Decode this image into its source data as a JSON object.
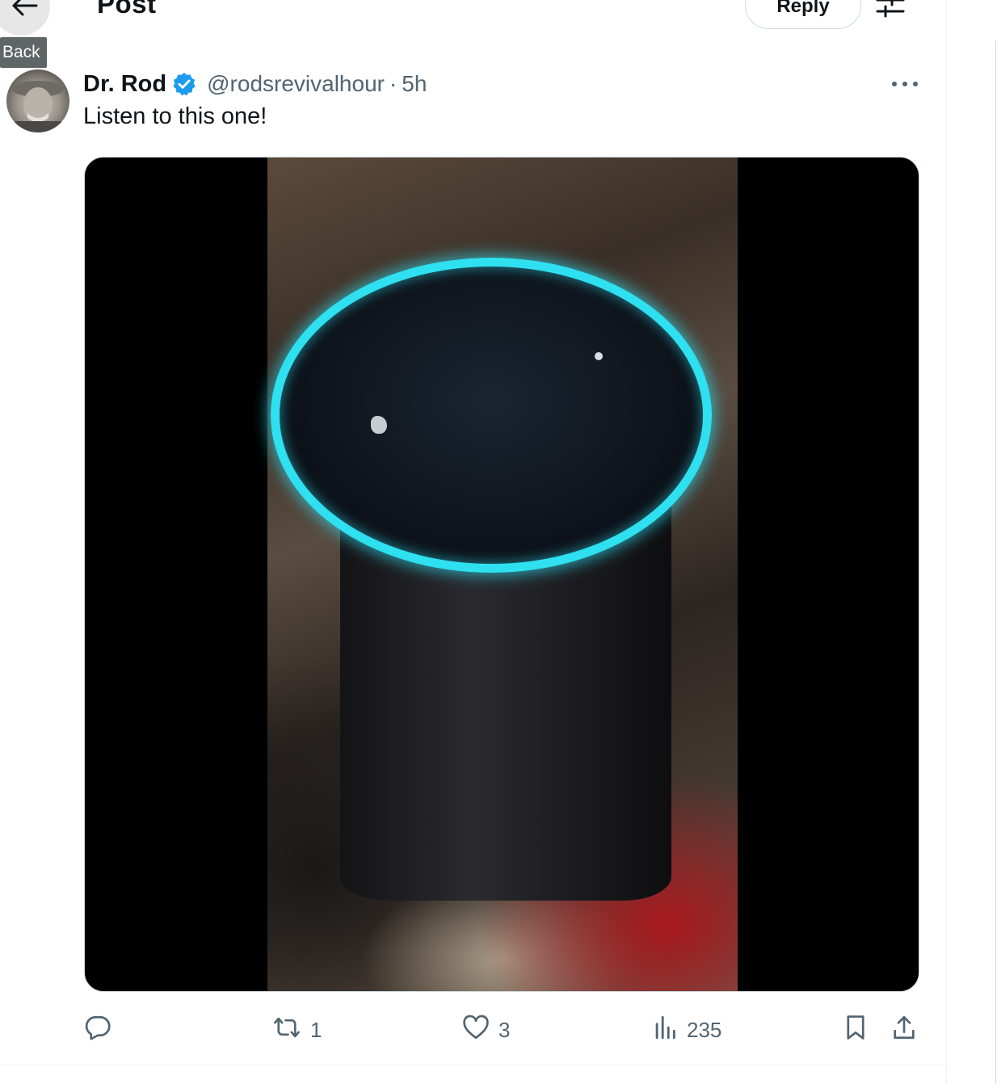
{
  "header": {
    "title": "Post",
    "back_tooltip": "Back",
    "reply_label": "Reply"
  },
  "post": {
    "author_name": "Dr. Rod",
    "handle": "@rodsrevivalhour",
    "separator": "·",
    "time": "5h",
    "text": "Listen to this one!"
  },
  "actions": {
    "replies": "",
    "reposts": "1",
    "likes": "3",
    "views": "235"
  },
  "icons": {
    "back": "arrow-left-icon",
    "settings": "sliders-icon",
    "verified": "verified-badge-icon",
    "more": "more-horizontal-icon",
    "reply": "comment-icon",
    "repost": "repost-icon",
    "like": "heart-icon",
    "views": "analytics-bars-icon",
    "bookmark": "bookmark-icon",
    "share": "share-upload-icon"
  },
  "colors": {
    "accent": "#1d9bf0",
    "text_secondary": "#536471",
    "ring": "#2ee0f0"
  }
}
